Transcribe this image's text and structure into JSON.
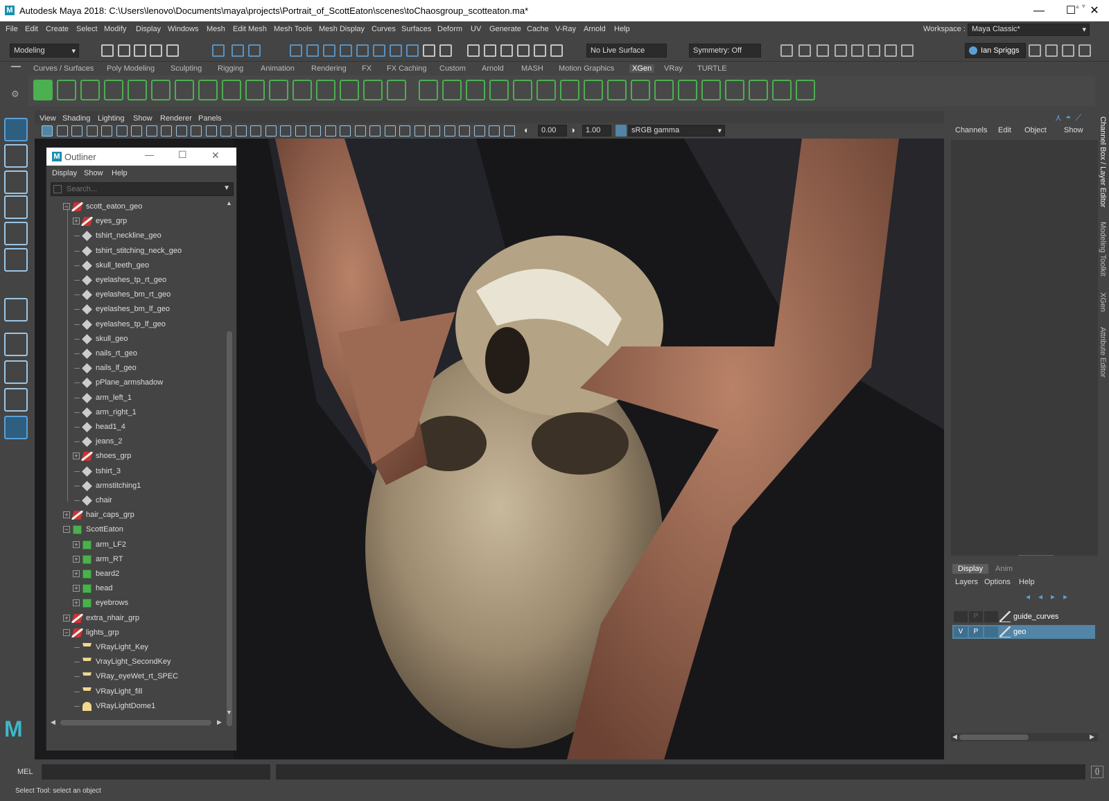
{
  "titlebar": {
    "title": "Autodesk Maya 2018: C:\\Users\\lenovo\\Documents\\maya\\projects\\Portrait_of_ScottEaton\\scenes\\toChaosgroup_scotteaton.ma*",
    "logo": "M"
  },
  "menubar": {
    "items": [
      "File",
      "Edit",
      "Create",
      "Select",
      "Modify",
      "Display",
      "Windows",
      "Mesh",
      "Edit Mesh",
      "Mesh Tools",
      "Mesh Display",
      "Curves",
      "Surfaces",
      "Deform",
      "UV",
      "Generate",
      "Cache",
      "V-Ray",
      "Arnold",
      "Help"
    ],
    "workspace_label": "Workspace :",
    "workspace_value": "Maya Classic*"
  },
  "statusline": {
    "mode": "Modeling",
    "live_surface": "No Live Surface",
    "symmetry": "Symmetry: Off",
    "user": "Ian Spriggs"
  },
  "shelf": {
    "tabs": [
      "Curves / Surfaces",
      "Poly Modeling",
      "Sculpting",
      "Rigging",
      "Animation",
      "Rendering",
      "FX",
      "FX Caching",
      "Custom",
      "Arnold",
      "MASH",
      "Motion Graphics",
      "XGen",
      "VRay",
      "TURTLE"
    ],
    "active_tab": "XGen"
  },
  "viewport": {
    "menu": [
      "View",
      "Shading",
      "Lighting",
      "Show",
      "Renderer",
      "Panels"
    ],
    "exposure": "0.00",
    "gamma": "1.00",
    "colorspace": "sRGB gamma"
  },
  "outliner": {
    "title": "Outliner",
    "menu": [
      "Display",
      "Show",
      "Help"
    ],
    "search_placeholder": "Search...",
    "rows": [
      {
        "label": "scott_eaton_geo",
        "depth": 0,
        "icon": "group-icon",
        "expand": "-"
      },
      {
        "label": "eyes_grp",
        "depth": 1,
        "icon": "group-icon",
        "expand": "+"
      },
      {
        "label": "tshirt_neckline_geo",
        "depth": 1,
        "icon": "mesh-icon",
        "expand": ""
      },
      {
        "label": "tshirt_stitching_neck_geo",
        "depth": 1,
        "icon": "mesh-icon",
        "expand": ""
      },
      {
        "label": "skull_teeth_geo",
        "depth": 1,
        "icon": "mesh-icon",
        "expand": ""
      },
      {
        "label": "eyelashes_tp_rt_geo",
        "depth": 1,
        "icon": "mesh-icon",
        "expand": ""
      },
      {
        "label": "eyelashes_bm_rt_geo",
        "depth": 1,
        "icon": "mesh-icon",
        "expand": ""
      },
      {
        "label": "eyelashes_bm_lf_geo",
        "depth": 1,
        "icon": "mesh-icon",
        "expand": ""
      },
      {
        "label": "eyelashes_tp_lf_geo",
        "depth": 1,
        "icon": "mesh-icon",
        "expand": ""
      },
      {
        "label": "skull_geo",
        "depth": 1,
        "icon": "mesh-icon",
        "expand": ""
      },
      {
        "label": "nails_rt_geo",
        "depth": 1,
        "icon": "mesh-icon",
        "expand": ""
      },
      {
        "label": "nails_lf_geo",
        "depth": 1,
        "icon": "mesh-icon",
        "expand": ""
      },
      {
        "label": "pPlane_armshadow",
        "depth": 1,
        "icon": "mesh-icon",
        "expand": ""
      },
      {
        "label": "arm_left_1",
        "depth": 1,
        "icon": "mesh-icon",
        "expand": ""
      },
      {
        "label": "arm_right_1",
        "depth": 1,
        "icon": "mesh-icon",
        "expand": ""
      },
      {
        "label": "head1_4",
        "depth": 1,
        "icon": "mesh-icon",
        "expand": ""
      },
      {
        "label": "jeans_2",
        "depth": 1,
        "icon": "mesh-icon",
        "expand": ""
      },
      {
        "label": "shoes_grp",
        "depth": 1,
        "icon": "group-icon",
        "expand": "+"
      },
      {
        "label": "tshirt_3",
        "depth": 1,
        "icon": "mesh-icon",
        "expand": ""
      },
      {
        "label": "armstitching1",
        "depth": 1,
        "icon": "mesh-icon",
        "expand": ""
      },
      {
        "label": "chair",
        "depth": 1,
        "icon": "mesh-icon",
        "expand": ""
      },
      {
        "label": "hair_caps_grp",
        "depth": 0,
        "icon": "group-icon",
        "expand": "+"
      },
      {
        "label": "ScottEaton",
        "depth": 0,
        "icon": "xgen-icon",
        "expand": "-"
      },
      {
        "label": "arm_LF2",
        "depth": 1,
        "icon": "xgen-icon",
        "expand": "+"
      },
      {
        "label": "arm_RT",
        "depth": 1,
        "icon": "xgen-icon",
        "expand": "+"
      },
      {
        "label": "beard2",
        "depth": 1,
        "icon": "xgen-icon",
        "expand": "+"
      },
      {
        "label": "head",
        "depth": 1,
        "icon": "xgen-icon",
        "expand": "+"
      },
      {
        "label": "eyebrows",
        "depth": 1,
        "icon": "xgen-icon",
        "expand": "+"
      },
      {
        "label": "extra_nhair_grp",
        "depth": 0,
        "icon": "group-icon",
        "expand": "+"
      },
      {
        "label": "lights_grp",
        "depth": 0,
        "icon": "group-icon",
        "expand": "-"
      },
      {
        "label": "VRayLight_Key",
        "depth": 1,
        "icon": "light-icon",
        "expand": ""
      },
      {
        "label": "VrayLight_SecondKey",
        "depth": 1,
        "icon": "light-icon",
        "expand": ""
      },
      {
        "label": "VRay_eyeWet_rt_SPEC",
        "depth": 1,
        "icon": "light-icon",
        "expand": ""
      },
      {
        "label": "VRayLight_fill",
        "depth": 1,
        "icon": "light-icon",
        "expand": ""
      },
      {
        "label": "VRayLightDome1",
        "depth": 1,
        "icon": "dome-icon",
        "expand": ""
      }
    ]
  },
  "channelbox": {
    "menu": [
      "Channels",
      "Edit",
      "Object",
      "Show"
    ]
  },
  "layers": {
    "tabs": [
      "Display",
      "Anim"
    ],
    "menu": [
      "Layers",
      "Options",
      "Help"
    ],
    "rows": [
      {
        "v": "",
        "p": "P",
        "name": "guide_curves",
        "selected": false
      },
      {
        "v": "V",
        "p": "P",
        "name": "geo",
        "selected": true
      }
    ]
  },
  "sidetabs": [
    "Channel Box / Layer Editor",
    "Modeling Toolkit",
    "XGen",
    "Attribute Editor"
  ],
  "cmdline": {
    "label": "MEL"
  },
  "helpline": {
    "text": "Select Tool: select an object"
  },
  "colors": {
    "accent": "#5285a6",
    "selected_layer": "#5285a6",
    "shelf_green": "#4caf50"
  }
}
